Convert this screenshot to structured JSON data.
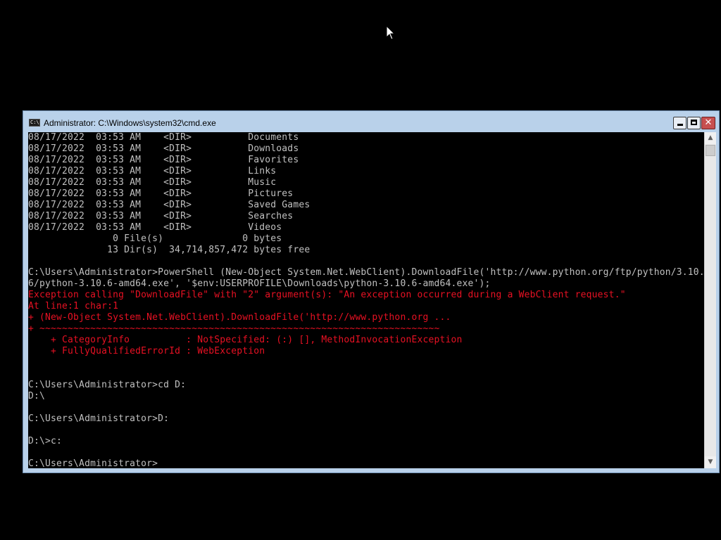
{
  "window": {
    "title": "Administrator: C:\\Windows\\system32\\cmd.exe",
    "icon_label": "C:\\",
    "minimize_glyph": "",
    "close_glyph": "✕"
  },
  "console": {
    "colors": {
      "normal": "#c0c0c0",
      "error": "#e81123",
      "background": "#000000"
    },
    "lines": [
      {
        "text": "08/17/2022  03:53 AM    <DIR>          Documents",
        "style": "gray"
      },
      {
        "text": "08/17/2022  03:53 AM    <DIR>          Downloads",
        "style": "gray"
      },
      {
        "text": "08/17/2022  03:53 AM    <DIR>          Favorites",
        "style": "gray"
      },
      {
        "text": "08/17/2022  03:53 AM    <DIR>          Links",
        "style": "gray"
      },
      {
        "text": "08/17/2022  03:53 AM    <DIR>          Music",
        "style": "gray"
      },
      {
        "text": "08/17/2022  03:53 AM    <DIR>          Pictures",
        "style": "gray"
      },
      {
        "text": "08/17/2022  03:53 AM    <DIR>          Saved Games",
        "style": "gray"
      },
      {
        "text": "08/17/2022  03:53 AM    <DIR>          Searches",
        "style": "gray"
      },
      {
        "text": "08/17/2022  03:53 AM    <DIR>          Videos",
        "style": "gray"
      },
      {
        "text": "               0 File(s)              0 bytes",
        "style": "gray"
      },
      {
        "text": "              13 Dir(s)  34,714,857,472 bytes free",
        "style": "gray"
      },
      {
        "text": "",
        "style": "gray"
      },
      {
        "text": "C:\\Users\\Administrator>PowerShell (New-Object System.Net.WebClient).DownloadFile('http://www.python.org/ftp/python/3.10.",
        "style": "gray"
      },
      {
        "text": "6/python-3.10.6-amd64.exe', '$env:USERPROFILE\\Downloads\\python-3.10.6-amd64.exe');",
        "style": "gray"
      },
      {
        "text": "Exception calling \"DownloadFile\" with \"2\" argument(s): \"An exception occurred during a WebClient request.\"",
        "style": "red"
      },
      {
        "text": "At line:1 char:1",
        "style": "red"
      },
      {
        "text": "+ (New-Object System.Net.WebClient).DownloadFile('http://www.python.org ...",
        "style": "red"
      },
      {
        "text": "+ ~~~~~~~~~~~~~~~~~~~~~~~~~~~~~~~~~~~~~~~~~~~~~~~~~~~~~~~~~~~~~~~~~~~~~~~",
        "style": "red"
      },
      {
        "text": "    + CategoryInfo          : NotSpecified: (:) [], MethodInvocationException",
        "style": "red"
      },
      {
        "text": "    + FullyQualifiedErrorId : WebException",
        "style": "red"
      },
      {
        "text": "",
        "style": "gray"
      },
      {
        "text": "",
        "style": "gray"
      },
      {
        "text": "C:\\Users\\Administrator>cd D:",
        "style": "gray"
      },
      {
        "text": "D:\\",
        "style": "gray"
      },
      {
        "text": "",
        "style": "gray"
      },
      {
        "text": "C:\\Users\\Administrator>D:",
        "style": "gray"
      },
      {
        "text": "",
        "style": "gray"
      },
      {
        "text": "D:\\>c:",
        "style": "gray"
      },
      {
        "text": "",
        "style": "gray"
      },
      {
        "text": "C:\\Users\\Administrator>",
        "style": "gray"
      }
    ]
  },
  "scrollbar": {
    "up_arrow": "▲",
    "down_arrow": "▼"
  }
}
